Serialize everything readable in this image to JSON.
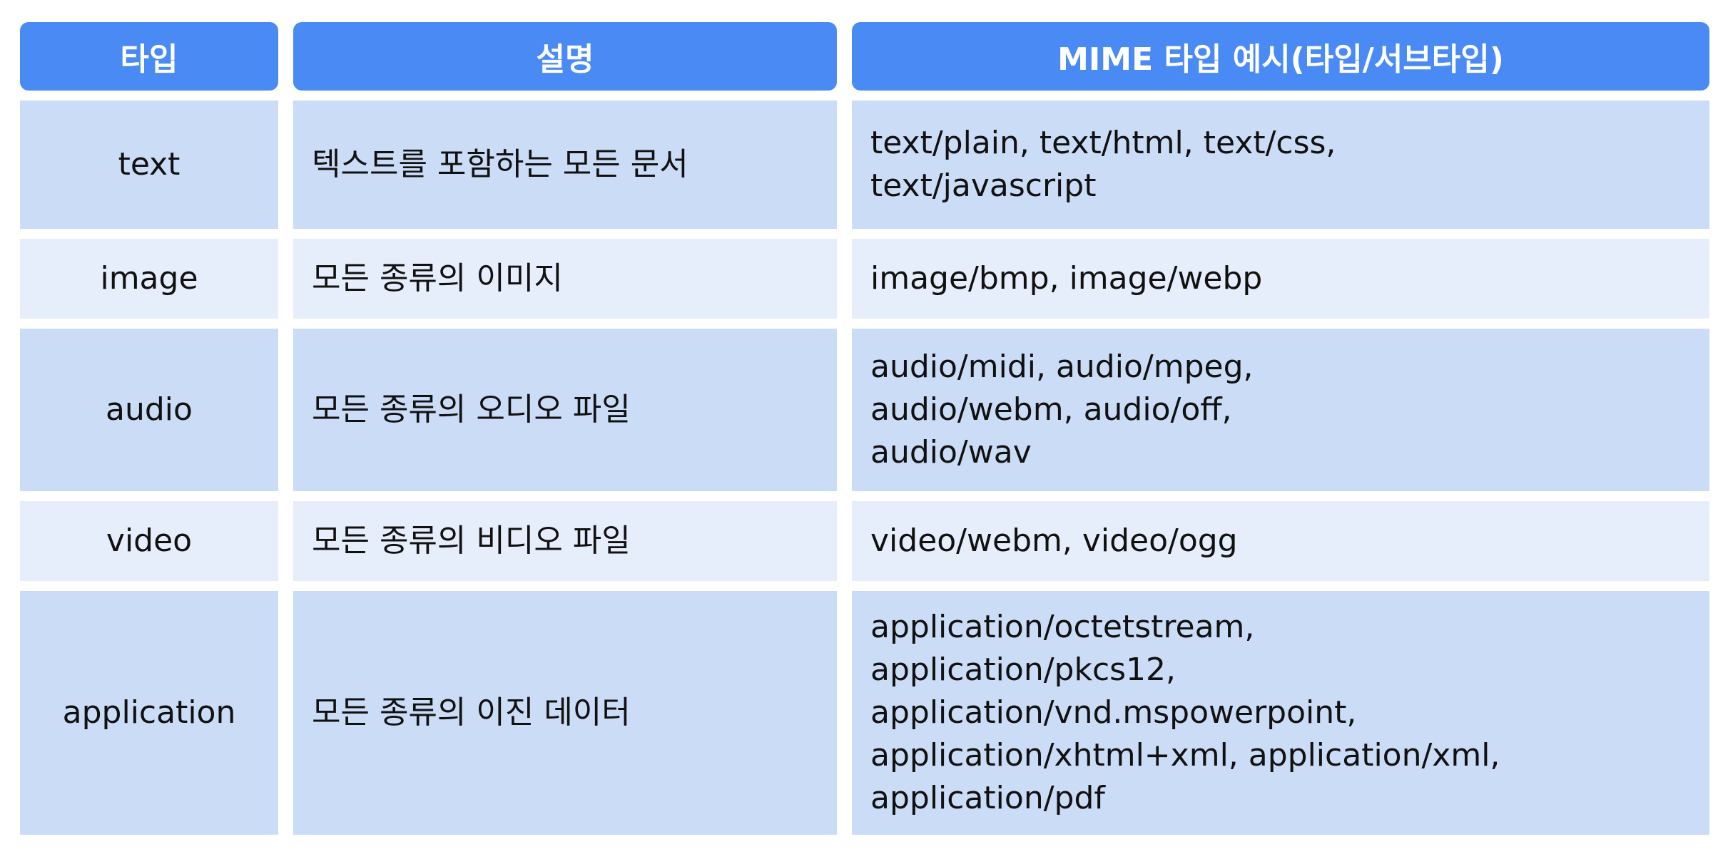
{
  "table": {
    "headers": [
      "타입",
      "설명",
      "MIME 타입 예시(타입/서브타입)"
    ],
    "rows": [
      {
        "type": "text",
        "description": "텍스트를 포함하는 모든 문서",
        "examples": "text/plain, text/html, text/css,\ntext/javascript",
        "shade": "dark"
      },
      {
        "type": "image",
        "description": "모든 종류의 이미지",
        "examples": "image/bmp, image/webp",
        "shade": "light"
      },
      {
        "type": "audio",
        "description": "모든 종류의 오디오 파일",
        "examples": "audio/midi, audio/mpeg,\naudio/webm, audio/off,\naudio/wav",
        "shade": "dark"
      },
      {
        "type": "video",
        "description": "모든 종류의 비디오 파일",
        "examples": "video/webm, video/ogg",
        "shade": "light"
      },
      {
        "type": "application",
        "description": "모든 종류의 이진 데이터",
        "examples": "application/octetstream,\napplication/pkcs12,\napplication/vnd.mspowerpoint,\napplication/xhtml+xml, application/xml,\napplication/pdf",
        "shade": "dark"
      }
    ]
  },
  "colors": {
    "header": "#4a8af4",
    "row_dark": "#cbdcf6",
    "row_light": "#e7eefb"
  }
}
